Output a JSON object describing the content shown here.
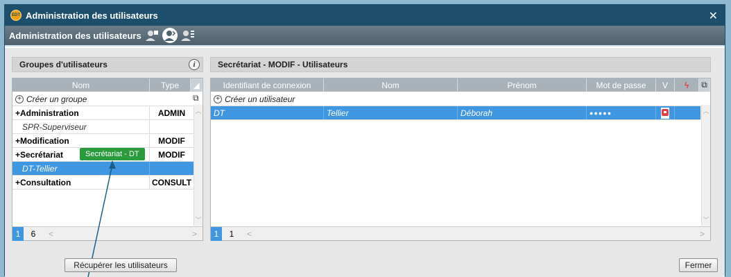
{
  "window": {
    "title": "Administration des utilisateurs",
    "logo_text": "EDT"
  },
  "subbar": {
    "title": "Administration des utilisateurs"
  },
  "left_panel": {
    "title": "Groupes d'utilisateurs",
    "columns": [
      "Nom",
      "Type"
    ],
    "create_label": "Créer un groupe",
    "rows": [
      {
        "name": "+Administration",
        "type": "ADMIN",
        "kind": "group"
      },
      {
        "name": "SPR-Superviseur",
        "type": "",
        "kind": "sub"
      },
      {
        "name": "+Modification",
        "type": "MODIF",
        "kind": "group"
      },
      {
        "name": "+Secrétariat",
        "type": "MODIF",
        "kind": "group"
      },
      {
        "name": "DT-Tellier",
        "type": "",
        "kind": "selected"
      },
      {
        "name": "+Consultation",
        "type": "CONSULT",
        "kind": "group"
      }
    ],
    "pager": {
      "current": "1",
      "total": "6"
    },
    "drag_badge": "Secrétariat - DT"
  },
  "right_panel": {
    "title": "Secrétariat - MODIF - Utilisateurs",
    "columns": [
      "Identifiant de connexion",
      "Nom",
      "Prénom",
      "Mot de passe",
      "V"
    ],
    "create_label": "Créer un utilisateur",
    "rows": [
      {
        "login": "DT",
        "nom": "Tellier",
        "prenom": "Déborah",
        "password": "●●●●●"
      }
    ],
    "pager": {
      "current": "1",
      "total": "1"
    }
  },
  "buttons": {
    "recuperer": "Récupérer les utilisateurs",
    "fermer": "Fermer"
  },
  "colors": {
    "titlebar": "#1d4e6b",
    "selection": "#3f97e2",
    "badge": "#2a9b3c"
  }
}
